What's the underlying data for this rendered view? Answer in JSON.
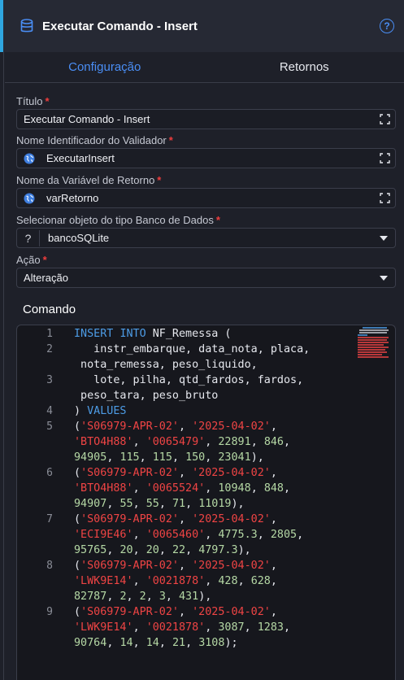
{
  "header": {
    "title": "Executar Comando - Insert",
    "help_symbol": "?"
  },
  "tabs": [
    {
      "label": "Configuração",
      "active": true
    },
    {
      "label": "Retornos",
      "active": false
    }
  ],
  "fields": {
    "titulo": {
      "label": "Título",
      "value": "Executar Comando - Insert"
    },
    "identificador": {
      "label": "Nome Identificador do Validador",
      "value": "ExecutarInsert"
    },
    "variavel": {
      "label": "Nome da Variável de Retorno",
      "value": "varRetorno"
    },
    "banco": {
      "label": "Selecionar objeto do tipo Banco de Dados",
      "value": "bancoSQLite",
      "prefix": "?"
    },
    "acao": {
      "label": "Ação",
      "value": "Alteração"
    }
  },
  "required_mark": "*",
  "command": {
    "label": "Comando",
    "line_numbers": [
      "1",
      "2",
      "3",
      "4",
      "5",
      "6",
      "7",
      "8",
      "9"
    ],
    "lines": [
      "INSERT INTO NF_Remessa (",
      "   instr_embarque, data_nota, placa,\n nota_remessa, peso_liquido,",
      "   lote, pilha, qtd_fardos, fardos,\n peso_tara, peso_bruto",
      ") VALUES",
      "('S06979-APR-02', '2025-04-02',\n'BTO4H88', '0065479', 22891, 846,\n94905, 115, 115, 150, 23041),",
      "('S06979-APR-02', '2025-04-02',\n'BTO4H88', '0065524', 10948, 848,\n94907, 55, 55, 71, 11019),",
      "('S06979-APR-02', '2025-04-02',\n'ECI9E46', '0065460', 4775.3, 2805,\n95765, 20, 20, 22, 4797.3),",
      "('S06979-APR-02', '2025-04-02',\n'LWK9E14', '0021878', 428, 628,\n82787, 2, 2, 3, 431),",
      "('S06979-APR-02', '2025-04-02',\n'LWK9E14', '0021878', 3087, 1283,\n90764, 14, 14, 21, 3108);"
    ]
  },
  "colors": {
    "accent": "#4a8ef5",
    "required": "#ef3d3d",
    "keyword": "#4d9ce6",
    "string": "#ef4444",
    "number": "#b5d8a5"
  },
  "icons": {
    "header": "database-icon",
    "help": "help-circle-icon",
    "expand": "expand-icon",
    "globe": "globe-icon",
    "select": "chevron-down-icon"
  }
}
